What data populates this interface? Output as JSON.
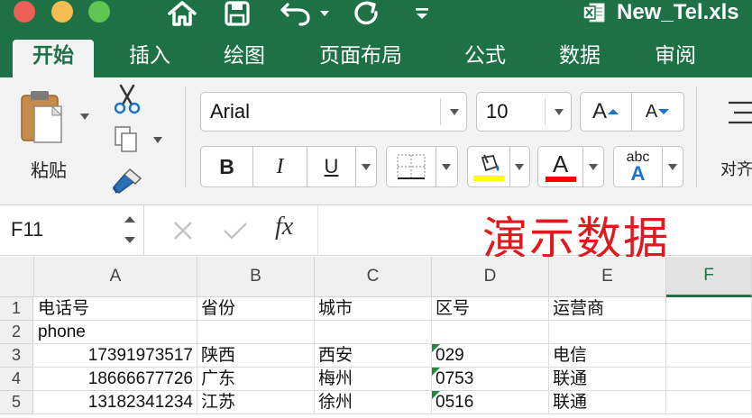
{
  "window": {
    "title": "New_Tel.xls",
    "accent": "#1e7145"
  },
  "ribbon_tabs": [
    {
      "label": "开始",
      "active": true
    },
    {
      "label": "插入"
    },
    {
      "label": "绘图"
    },
    {
      "label": "页面布局"
    },
    {
      "label": "公式"
    },
    {
      "label": "数据"
    },
    {
      "label": "审阅"
    }
  ],
  "home_ribbon": {
    "paste_label": "粘贴",
    "font_name": "Arial",
    "font_size": "10",
    "bold": "B",
    "italic": "I",
    "underline": "U",
    "font_color_letter": "A",
    "grow_font": "A",
    "shrink_font": "A",
    "abc_label": "abc",
    "abc_letter": "A",
    "align_label": "对齐",
    "fill_color": "#ffff00",
    "font_color": "#ff0000"
  },
  "formula_bar": {
    "cell_ref": "F11",
    "fx_label": "fx",
    "formula": ""
  },
  "overlay_caption": "演示数据",
  "sheet": {
    "columns": [
      "A",
      "B",
      "C",
      "D",
      "E",
      "F"
    ],
    "selected_column": "F",
    "rows": [
      {
        "num": "1",
        "cells": [
          "电话号",
          "省份",
          "城市",
          "区号",
          "运营商",
          ""
        ]
      },
      {
        "num": "2",
        "cells": [
          "phone",
          "",
          "",
          "",
          "",
          ""
        ]
      },
      {
        "num": "3",
        "cells": [
          "17391973517",
          "陕西",
          "西安",
          "029",
          "电信",
          ""
        ]
      },
      {
        "num": "4",
        "cells": [
          "18666677726",
          "广东",
          "梅州",
          "0753",
          "联通",
          ""
        ]
      },
      {
        "num": "5",
        "cells": [
          "13182341234",
          "江苏",
          "徐州",
          "0516",
          "联通",
          ""
        ]
      }
    ]
  }
}
